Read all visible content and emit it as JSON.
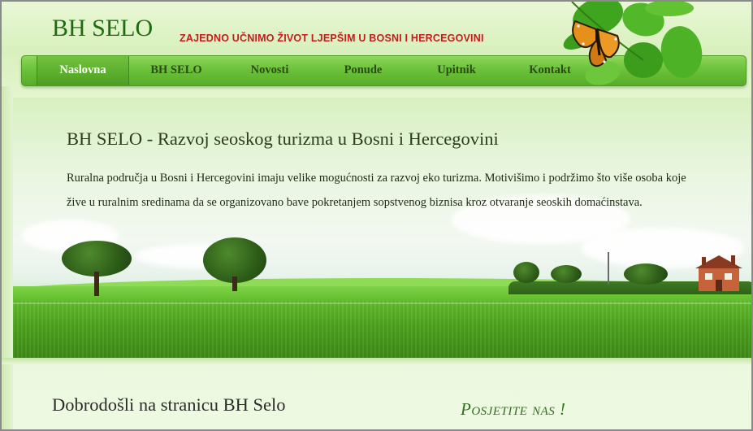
{
  "header": {
    "logo": "BH SELO",
    "slogan": "ZAJEDNO UČNIMO ŽIVOT LJEPŠIM U BOSNI I HERCEGOVINI"
  },
  "nav": {
    "items": [
      {
        "label": "Naslovna",
        "active": true
      },
      {
        "label": "BH SELO",
        "active": false
      },
      {
        "label": "Novosti",
        "active": false
      },
      {
        "label": "Ponude",
        "active": false
      },
      {
        "label": "Upitnik",
        "active": false
      },
      {
        "label": "Kontakt",
        "active": false
      }
    ]
  },
  "hero": {
    "title": "BH SELO - Razvoj seoskog turizma u Bosni i Hercegovini",
    "text": "Ruralna područja u Bosni i Hercegovini imaju velike mogućnosti za razvoj eko turizma. Motivišimo i podržimo što više osoba koje žive u ruralnim sredinama da se organizovano bave pokretanjem sopstvenog biznisa kroz otvaranje seoskih domaćinstava."
  },
  "content": {
    "welcome_heading": "Dobrodošli na stranicu BH Selo",
    "visit_heading": "Posjetite nas !"
  },
  "colors": {
    "logo": "#1e6b12",
    "slogan": "#c41b1b",
    "nav_green": "#6cc23a",
    "grass": "#4da21d"
  },
  "icons": [
    "butterfly-icon",
    "leaf-icon"
  ]
}
